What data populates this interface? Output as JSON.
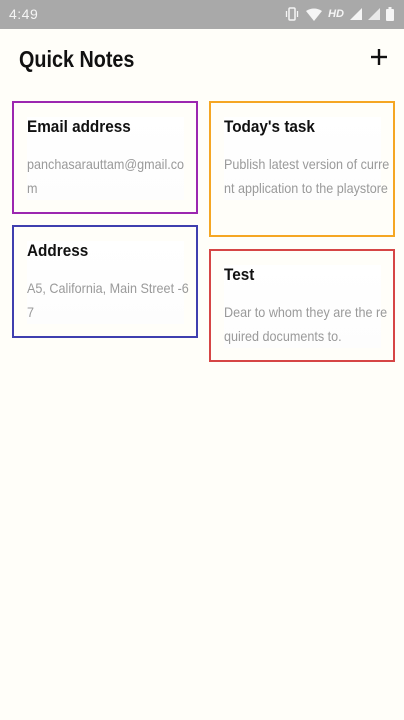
{
  "status_bar": {
    "time": "4:49",
    "network_label": "HD",
    "icons": [
      "vibrate-icon",
      "wifi-icon",
      "signal-icon",
      "signal-icon",
      "battery-icon"
    ]
  },
  "header": {
    "title": "Quick Notes",
    "add_icon": "plus-icon"
  },
  "notes": [
    {
      "title": "Email address",
      "body": "panchasarauttam@gmail.com",
      "border_color": "#9c27b0"
    },
    {
      "title": "Address",
      "body": "A5, California, Main Street -67",
      "border_color": "#3f3faf"
    },
    {
      "title": "Today's task",
      "body": "Publish latest version of current application to the playstore",
      "border_color": "#f5a623"
    },
    {
      "title": "Test",
      "body": "Dear to whom they are the required documents to.",
      "border_color": "#d64545"
    }
  ]
}
